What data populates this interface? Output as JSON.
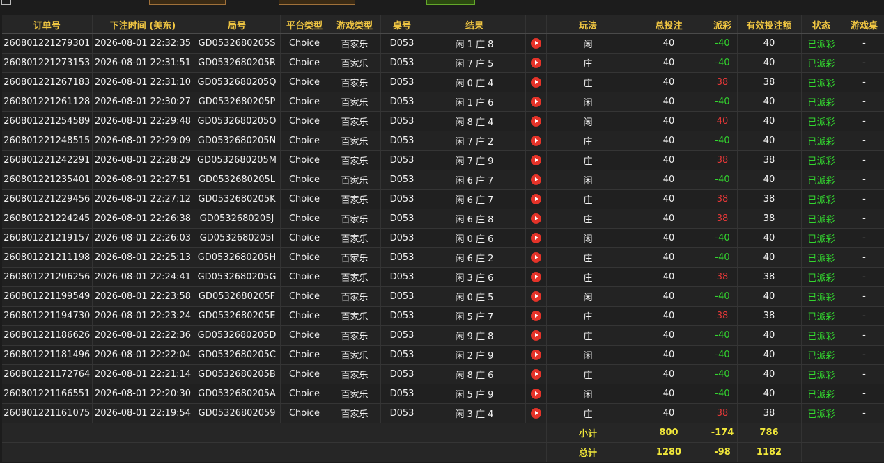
{
  "colors": {
    "header_text": "#f0c642",
    "win_green": "#33d62f",
    "loss_red": "#e53838",
    "summary_text": "#f0e63a",
    "play_icon": "#e53329"
  },
  "table": {
    "headers": [
      "订单号",
      "下注时间 (美东)",
      "局号",
      "平台类型",
      "游戏类型",
      "桌号",
      "结果",
      "",
      "玩法",
      "总投注",
      "派彩",
      "有效投注额",
      "状态",
      "游戏桌"
    ],
    "rows": [
      {
        "order": "260801221279301",
        "time": "2026-08-01 22:32:35",
        "round": "GD0532680205S",
        "platform": "Choice",
        "game": "百家乐",
        "table": "D053",
        "result": "闲 1 庄 8",
        "play": "闲",
        "bet": "40",
        "payout": "-40",
        "payout_color": "green",
        "valid": "40",
        "status": "已派彩",
        "extra": "-"
      },
      {
        "order": "260801221273153",
        "time": "2026-08-01 22:31:51",
        "round": "GD0532680205R",
        "platform": "Choice",
        "game": "百家乐",
        "table": "D053",
        "result": "闲 7 庄 5",
        "play": "庄",
        "bet": "40",
        "payout": "-40",
        "payout_color": "green",
        "valid": "40",
        "status": "已派彩",
        "extra": "-"
      },
      {
        "order": "260801221267183",
        "time": "2026-08-01 22:31:10",
        "round": "GD0532680205Q",
        "platform": "Choice",
        "game": "百家乐",
        "table": "D053",
        "result": "闲 0 庄 4",
        "play": "庄",
        "bet": "40",
        "payout": "38",
        "payout_color": "red",
        "valid": "38",
        "status": "已派彩",
        "extra": "-"
      },
      {
        "order": "260801221261128",
        "time": "2026-08-01 22:30:27",
        "round": "GD0532680205P",
        "platform": "Choice",
        "game": "百家乐",
        "table": "D053",
        "result": "闲 1 庄 6",
        "play": "闲",
        "bet": "40",
        "payout": "-40",
        "payout_color": "green",
        "valid": "40",
        "status": "已派彩",
        "extra": "-"
      },
      {
        "order": "260801221254589",
        "time": "2026-08-01 22:29:48",
        "round": "GD0532680205O",
        "platform": "Choice",
        "game": "百家乐",
        "table": "D053",
        "result": "闲 8 庄 4",
        "play": "闲",
        "bet": "40",
        "payout": "40",
        "payout_color": "red",
        "valid": "40",
        "status": "已派彩",
        "extra": "-"
      },
      {
        "order": "260801221248515",
        "time": "2026-08-01 22:29:09",
        "round": "GD0532680205N",
        "platform": "Choice",
        "game": "百家乐",
        "table": "D053",
        "result": "闲 7 庄 2",
        "play": "庄",
        "bet": "40",
        "payout": "-40",
        "payout_color": "green",
        "valid": "40",
        "status": "已派彩",
        "extra": "-"
      },
      {
        "order": "260801221242291",
        "time": "2026-08-01 22:28:29",
        "round": "GD0532680205M",
        "platform": "Choice",
        "game": "百家乐",
        "table": "D053",
        "result": "闲 7 庄 9",
        "play": "庄",
        "bet": "40",
        "payout": "38",
        "payout_color": "red",
        "valid": "38",
        "status": "已派彩",
        "extra": "-"
      },
      {
        "order": "260801221235401",
        "time": "2026-08-01 22:27:51",
        "round": "GD0532680205L",
        "platform": "Choice",
        "game": "百家乐",
        "table": "D053",
        "result": "闲 6 庄 7",
        "play": "闲",
        "bet": "40",
        "payout": "-40",
        "payout_color": "green",
        "valid": "40",
        "status": "已派彩",
        "extra": "-"
      },
      {
        "order": "260801221229456",
        "time": "2026-08-01 22:27:12",
        "round": "GD0532680205K",
        "platform": "Choice",
        "game": "百家乐",
        "table": "D053",
        "result": "闲 6 庄 7",
        "play": "庄",
        "bet": "40",
        "payout": "38",
        "payout_color": "red",
        "valid": "38",
        "status": "已派彩",
        "extra": "-"
      },
      {
        "order": "260801221224245",
        "time": "2026-08-01 22:26:38",
        "round": "GD0532680205J",
        "platform": "Choice",
        "game": "百家乐",
        "table": "D053",
        "result": "闲 6 庄 8",
        "play": "庄",
        "bet": "40",
        "payout": "38",
        "payout_color": "red",
        "valid": "38",
        "status": "已派彩",
        "extra": "-"
      },
      {
        "order": "260801221219157",
        "time": "2026-08-01 22:26:03",
        "round": "GD0532680205I",
        "platform": "Choice",
        "game": "百家乐",
        "table": "D053",
        "result": "闲 0 庄 6",
        "play": "闲",
        "bet": "40",
        "payout": "-40",
        "payout_color": "green",
        "valid": "40",
        "status": "已派彩",
        "extra": "-"
      },
      {
        "order": "260801221211198",
        "time": "2026-08-01 22:25:13",
        "round": "GD0532680205H",
        "platform": "Choice",
        "game": "百家乐",
        "table": "D053",
        "result": "闲 6 庄 2",
        "play": "庄",
        "bet": "40",
        "payout": "-40",
        "payout_color": "green",
        "valid": "40",
        "status": "已派彩",
        "extra": "-"
      },
      {
        "order": "260801221206256",
        "time": "2026-08-01 22:24:41",
        "round": "GD0532680205G",
        "platform": "Choice",
        "game": "百家乐",
        "table": "D053",
        "result": "闲 3 庄 6",
        "play": "庄",
        "bet": "40",
        "payout": "38",
        "payout_color": "red",
        "valid": "38",
        "status": "已派彩",
        "extra": "-"
      },
      {
        "order": "260801221199549",
        "time": "2026-08-01 22:23:58",
        "round": "GD0532680205F",
        "platform": "Choice",
        "game": "百家乐",
        "table": "D053",
        "result": "闲 0 庄 5",
        "play": "闲",
        "bet": "40",
        "payout": "-40",
        "payout_color": "green",
        "valid": "40",
        "status": "已派彩",
        "extra": "-"
      },
      {
        "order": "260801221194730",
        "time": "2026-08-01 22:23:24",
        "round": "GD0532680205E",
        "platform": "Choice",
        "game": "百家乐",
        "table": "D053",
        "result": "闲 5 庄 7",
        "play": "庄",
        "bet": "40",
        "payout": "38",
        "payout_color": "red",
        "valid": "38",
        "status": "已派彩",
        "extra": "-"
      },
      {
        "order": "260801221186626",
        "time": "2026-08-01 22:22:36",
        "round": "GD0532680205D",
        "platform": "Choice",
        "game": "百家乐",
        "table": "D053",
        "result": "闲 9 庄 8",
        "play": "庄",
        "bet": "40",
        "payout": "-40",
        "payout_color": "green",
        "valid": "40",
        "status": "已派彩",
        "extra": "-"
      },
      {
        "order": "260801221181496",
        "time": "2026-08-01 22:22:04",
        "round": "GD0532680205C",
        "platform": "Choice",
        "game": "百家乐",
        "table": "D053",
        "result": "闲 2 庄 9",
        "play": "闲",
        "bet": "40",
        "payout": "-40",
        "payout_color": "green",
        "valid": "40",
        "status": "已派彩",
        "extra": "-"
      },
      {
        "order": "260801221172764",
        "time": "2026-08-01 22:21:14",
        "round": "GD0532680205B",
        "platform": "Choice",
        "game": "百家乐",
        "table": "D053",
        "result": "闲 8 庄 6",
        "play": "庄",
        "bet": "40",
        "payout": "-40",
        "payout_color": "green",
        "valid": "40",
        "status": "已派彩",
        "extra": "-"
      },
      {
        "order": "260801221166551",
        "time": "2026-08-01 22:20:30",
        "round": "GD0532680205A",
        "platform": "Choice",
        "game": "百家乐",
        "table": "D053",
        "result": "闲 5 庄 9",
        "play": "闲",
        "bet": "40",
        "payout": "-40",
        "payout_color": "green",
        "valid": "40",
        "status": "已派彩",
        "extra": "-"
      },
      {
        "order": "260801221161075",
        "time": "2026-08-01 22:19:54",
        "round": "GD05326802059",
        "platform": "Choice",
        "game": "百家乐",
        "table": "D053",
        "result": "闲 3 庄 4",
        "play": "庄",
        "bet": "40",
        "payout": "38",
        "payout_color": "red",
        "valid": "38",
        "status": "已派彩",
        "extra": "-"
      }
    ],
    "subtotal": {
      "label": "小计",
      "bet": "800",
      "payout": "-174",
      "valid": "786"
    },
    "total": {
      "label": "总计",
      "bet": "1280",
      "payout": "-98",
      "valid": "1182"
    }
  }
}
